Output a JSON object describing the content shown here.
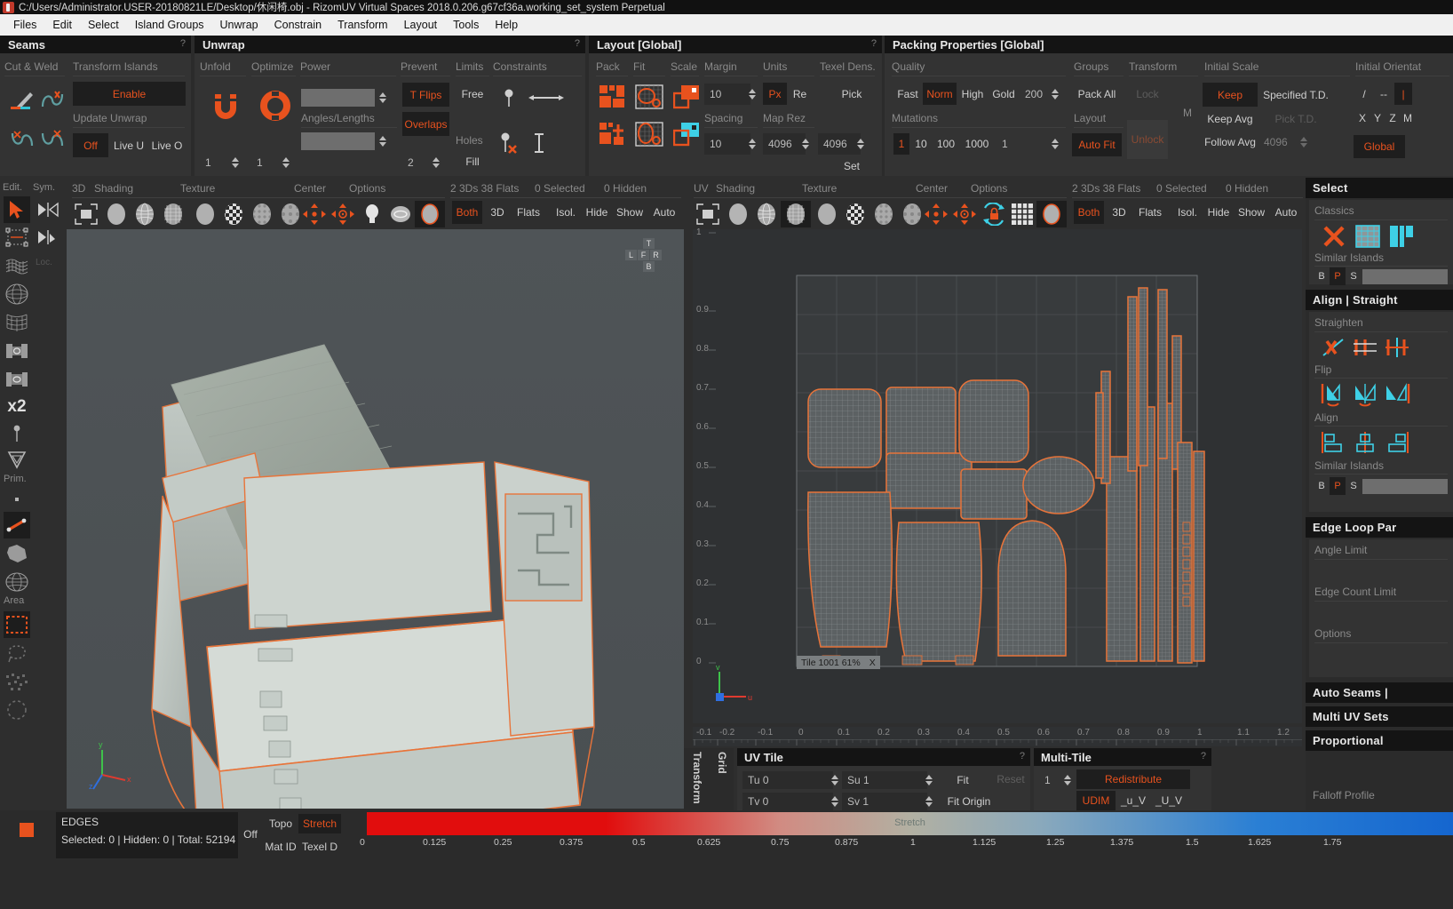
{
  "window": {
    "title": "C:/Users/Administrator.USER-20180821LE/Desktop/休闲椅.obj - RizomUV  Virtual Spaces 2018.0.206.g67cf36a.working_set_system Perpetual",
    "app_icon": "rizomuv-logo-icon"
  },
  "menu": {
    "items": [
      "Files",
      "Edit",
      "Select",
      "Island Groups",
      "Unwrap",
      "Constrain",
      "Transform",
      "Layout",
      "Tools",
      "Help"
    ]
  },
  "seams_panel": {
    "title": "Seams",
    "help": "?",
    "cut_weld_label": "Cut & Weld",
    "transform_islands_label": "Transform Islands",
    "enable_label": "Enable",
    "update_unwrap_label": "Update Unwrap",
    "off_label": "Off",
    "live_u_label": "Live U",
    "live_o_label": "Live O",
    "icons": [
      "cut-knife-icon",
      "weld-icon",
      "unweld-icon",
      "weld-all-icon"
    ]
  },
  "unwrap_panel": {
    "title": "Unwrap",
    "help": "?",
    "unfold_label": "Unfold",
    "optimize_label": "Optimize",
    "power_label": "Power",
    "angles_lengths_label": "Angles/Lengths",
    "prevent_label": "Prevent",
    "limits_label": "Limits",
    "constraints_label": "Constraints",
    "t_flips_label": "T Flips",
    "overlaps_label": "Overlaps",
    "free_label": "Free",
    "holes_label": "Holes",
    "fill_label": "Fill",
    "unfold_value": "1",
    "optimize_value": "1",
    "prevent_value": "2",
    "unfold_icon": "unfold-u-icon",
    "optimize_icon": "optimize-o-icon",
    "constraint_icons": [
      "pin-icon",
      "edge-length-icon",
      "pin-delete-icon",
      "axis-lock-icon"
    ]
  },
  "layout_panel": {
    "title": "Layout [Global]",
    "help": "?",
    "pack_label": "Pack",
    "fit_label": "Fit",
    "scale_label": "Scale",
    "margin_label": "Margin",
    "units_label": "Units",
    "texel_dens_label": "Texel Dens.",
    "spacing_label": "Spacing",
    "map_rez_label": "Map Rez",
    "margin_value": "10",
    "spacing_value": "10",
    "map_rez_value": "4096",
    "texel_value": "4096",
    "units_px": "Px",
    "units_re": "Re",
    "pick_label": "Pick",
    "set_label": "Set",
    "icons": [
      "pack-icon",
      "pack-move-icon",
      "fit-icon",
      "fit-orient-icon",
      "scale-icon",
      "scale-cyan-icon"
    ]
  },
  "packing_panel": {
    "title": "Packing Properties [Global]",
    "help": "?",
    "quality_label": "Quality",
    "mutations_label": "Mutations",
    "groups_label": "Groups",
    "transform_label": "Transform",
    "initial_scale_label": "Initial Scale",
    "initial_orientation_label": "Initial Orientat",
    "quality_options": [
      "Fast",
      "Norm",
      "High",
      "Gold"
    ],
    "quality_selected": "Norm",
    "quality_value": "200",
    "mutations_options": [
      "1",
      "10",
      "100",
      "1000"
    ],
    "mutations_selected": "1",
    "mutations_value": "1",
    "pack_all_label": "Pack All",
    "layout_label": "Layout",
    "auto_fit_label": "Auto Fit",
    "lock_label": "Lock",
    "unlock_label": "Unlock",
    "m_label": "M",
    "keep_label": "Keep",
    "keep_avg_label": "Keep Avg",
    "follow_avg_label": "Follow Avg",
    "specified_td_label": "Specified T.D.",
    "pick_td_label": "Pick T.D.",
    "td_value": "4096",
    "orient_slash": "/",
    "orient_dash": "--",
    "orient_bar": "|",
    "axes": [
      "X",
      "Y",
      "Z",
      "M"
    ],
    "global_label": "Global"
  },
  "left_toolbar": {
    "edit_label": "Edit.",
    "sym_label": "Sym.",
    "prim_label": "Prim.",
    "area_label": "Area",
    "loc_label": "Loc.",
    "x2_label": "x2",
    "items": [
      {
        "name": "select-arrow-icon",
        "active": true
      },
      {
        "name": "move-box-icon",
        "active": false
      },
      {
        "name": "deform-grid-icon",
        "active": false
      },
      {
        "name": "sphere-grid-icon",
        "active": false
      },
      {
        "name": "flatten-grid-icon",
        "active": false
      },
      {
        "name": "symmetry-h-icon",
        "active": false
      },
      {
        "name": "symmetry-v-icon",
        "active": false
      },
      {
        "name": "x2-icon",
        "active": false
      },
      {
        "name": "pin-icon",
        "active": false
      },
      {
        "name": "shield-icon",
        "active": false
      },
      {
        "name": "point-icon",
        "active": false
      },
      {
        "name": "edge-icon",
        "active": true
      },
      {
        "name": "polygon-icon",
        "active": false
      },
      {
        "name": "island-icon",
        "active": false
      },
      {
        "name": "rect-select-icon",
        "active": true
      },
      {
        "name": "lasso-select-icon",
        "active": false
      },
      {
        "name": "paint-select-icon",
        "active": false
      },
      {
        "name": "circle-select-icon",
        "active": false
      }
    ],
    "sym_items": [
      "mirror-right-icon",
      "mirror-pick-icon"
    ]
  },
  "viewport_3d": {
    "toolbar": {
      "mode_label": "3D",
      "shading_label": "Shading",
      "texture_label": "Texture",
      "center_label": "Center",
      "options_label": "Options",
      "counts_label": "2 3Ds 38 Flats",
      "selected_label": "0 Selected",
      "hidden_label": "0 Hidden",
      "both_label": "Both",
      "threed_label": "3D",
      "flats_label": "Flats",
      "isol_label": "Isol.",
      "hide_label": "Hide",
      "show_label": "Show",
      "auto_label": "Auto",
      "active_filter": "Both"
    },
    "gizmo": {
      "top": "T",
      "left": "L",
      "bottom": "B",
      "front": "F",
      "right": "R",
      "back": "B"
    },
    "axis": {
      "x": "x",
      "y": "y",
      "z": "z"
    }
  },
  "viewport_uv": {
    "toolbar": {
      "mode_label": "UV",
      "shading_label": "Shading",
      "texture_label": "Texture",
      "center_label": "Center",
      "options_label": "Options",
      "counts_label": "2 3Ds 38 Flats",
      "selected_label": "0 Selected",
      "hidden_label": "0 Hidden",
      "both_label": "Both",
      "threed_label": "3D",
      "flats_label": "Flats",
      "isol_label": "Isol.",
      "hide_label": "Hide",
      "show_label": "Show",
      "auto_label": "Auto",
      "active_filter": "Both"
    },
    "tile_badge": "Tile 1001 61%",
    "tile_close": "X",
    "axis": {
      "u": "u",
      "v": "v"
    },
    "ruler_labels": [
      "-0.1",
      "-0.2",
      "-0.1",
      "0",
      "0.1",
      "0.2",
      "0.3",
      "0.4",
      "0.5",
      "0.6",
      "0.7",
      "0.8",
      "0.9",
      "1",
      "1.1",
      "1.2"
    ],
    "ruler_v_labels": [
      "1",
      "0.9",
      "0.8",
      "0.7",
      "0.6",
      "0.5",
      "0.4",
      "0.3",
      "0.2",
      "0.1",
      "0"
    ]
  },
  "uv_tile_panel": {
    "transform_tab": "Transform",
    "grid_tab": "Grid",
    "title": "UV Tile",
    "help": "?",
    "tu_label": "Tu 0",
    "tv_label": "Tv 0",
    "su_label": "Su 1",
    "sv_label": "Sv 1",
    "fit_label": "Fit",
    "fit_origin_label": "Fit Origin",
    "reset_label": "Reset"
  },
  "multi_tile_panel": {
    "title": "Multi-Tile",
    "help": "?",
    "count_value": "1",
    "redistribute_label": "Redistribute",
    "udim_label": "UDIM",
    "u_v_label": "_u_V",
    "uu_v_label": "_U_V"
  },
  "right_sidebar": {
    "select_section": {
      "title": "Select",
      "classics_label": "Classics",
      "similar_islands_label": "Similar Islands",
      "bps": [
        "B",
        "P",
        "S"
      ],
      "bps_active": "P",
      "icons": [
        "deselect-all-icon",
        "select-grid-icon",
        "select-partial-icon"
      ]
    },
    "align_section": {
      "title": "Align | Straight",
      "straighten_label": "Straighten",
      "flip_label": "Flip",
      "align_label": "Align",
      "similar_islands_label": "Similar Islands",
      "bps": [
        "B",
        "P",
        "S"
      ],
      "bps_active": "P",
      "straighten_icons": [
        "straighten-free-icon",
        "straighten-h-icon",
        "straighten-v-icon"
      ],
      "flip_icons": [
        "flip-h-icon",
        "flip-v-icon",
        "flip-diag-icon"
      ],
      "align_icons": [
        "align-left-icon",
        "align-center-icon",
        "align-right-icon"
      ]
    },
    "edge_loop_section": {
      "title": "Edge Loop Par",
      "angle_limit_label": "Angle Limit",
      "edge_count_limit_label": "Edge Count Limit",
      "options_label": "Options"
    },
    "auto_seams_title": "Auto Seams | ",
    "multi_uv_title": "Multi UV Sets",
    "proportional_title": "Proportional",
    "falloff_label": "Falloff Profile"
  },
  "status_bar": {
    "mode_label": "EDGES",
    "counts_label": "Selected: 0 | Hidden: 0 | Total: 52194",
    "color_swatch": "#e8521e",
    "off_label": "Off",
    "topo_label": "Topo",
    "stretch_label": "Stretch",
    "mat_id_label": "Mat ID",
    "texel_d_label": "Texel D",
    "active_display": "Stretch",
    "gradient_title": "Stretch",
    "scale_labels": [
      "0",
      "0.125",
      "0.25",
      "0.375",
      "0.5",
      "0.625",
      "0.75",
      "0.875",
      "1",
      "1.125",
      "1.25",
      "1.375",
      "1.5",
      "1.625",
      "1.75"
    ]
  }
}
